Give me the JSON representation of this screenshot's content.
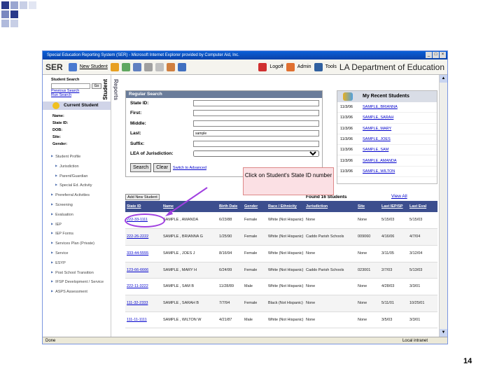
{
  "browser": {
    "title": "Special Education Reporting System (SER) - Microsoft Internet Explorer provided by Computer Aid, Inc.",
    "status_left": "Done",
    "status_right": "Local intranet"
  },
  "toolbar": {
    "app_short": "SER",
    "new_student": "New Student",
    "logoff": "Logoff",
    "admin": "Admin",
    "tools": "Tools",
    "dept": "LA Department of Education"
  },
  "left": {
    "search_title": "Student Search",
    "go": "Go",
    "links": [
      "Previous Search",
      "Run Search"
    ],
    "current": "Current Student",
    "fields": [
      "Name:",
      "State ID:",
      "DOB:",
      "Site:",
      "Gender:"
    ],
    "nav": [
      {
        "label": "Student Profile",
        "sub": false
      },
      {
        "label": "Jurisdiction",
        "sub": true
      },
      {
        "label": "Parent/Guardian",
        "sub": true
      },
      {
        "label": "Special Ed. Activity",
        "sub": true
      },
      {
        "label": "Prereferral Activities",
        "sub": false
      },
      {
        "label": "Screening",
        "sub": false
      },
      {
        "label": "Evaluation",
        "sub": false
      },
      {
        "label": "IEP",
        "sub": false
      },
      {
        "label": "IEP Forms",
        "sub": false
      },
      {
        "label": "Services Plan (Private)",
        "sub": false
      },
      {
        "label": "Service",
        "sub": false
      },
      {
        "label": "ESYP",
        "sub": false
      },
      {
        "label": "Post School Transition",
        "sub": false
      },
      {
        "label": "IFSP Development / Service",
        "sub": false
      },
      {
        "label": "ASPS Assessment",
        "sub": false
      }
    ]
  },
  "tabs": {
    "student": "Student",
    "reports": "Reports"
  },
  "search": {
    "title": "Regular Search",
    "fields": [
      {
        "label": "State ID:",
        "value": ""
      },
      {
        "label": "First:",
        "value": ""
      },
      {
        "label": "Middle:",
        "value": ""
      },
      {
        "label": "Last:",
        "value": "sample"
      },
      {
        "label": "Suffix:",
        "value": ""
      }
    ],
    "lea_label": "LEA of Jurisdiction:",
    "btn_search": "Search",
    "btn_clear": "Clear",
    "switch_link": "Switch to Advanced"
  },
  "recent": {
    "title": "My Recent Students",
    "items": [
      {
        "date": "11/3/06",
        "name": "SAMPLE, BRIANNA"
      },
      {
        "date": "11/3/06",
        "name": "SAMPLE, SARAH"
      },
      {
        "date": "11/3/06",
        "name": "SAMPLE, MARY"
      },
      {
        "date": "11/3/06",
        "name": "SAMPLE, JOES"
      },
      {
        "date": "11/3/06",
        "name": "SAMPLE, SAM"
      },
      {
        "date": "11/3/06",
        "name": "SAMPLE, AMANDA"
      },
      {
        "date": "11/3/06",
        "name": "SAMPLE, WILTON"
      }
    ]
  },
  "callout": "Click on Student's State ID number",
  "results": {
    "add_btn": "Add New Student",
    "found": "Found 16 Students",
    "view_all": "View All",
    "headers": [
      "State ID",
      "Name",
      "Birth Date",
      "Gender",
      "Race / Ethnicity",
      "Jurisdiction",
      "Site",
      "Last IEP/SP",
      "Last Eval"
    ],
    "rows": [
      [
        "222-33-1111",
        "SAMPLE , AMANDA",
        "6/23/88",
        "Female",
        "White (Not Hispanic)",
        "None",
        "None",
        "5/15/03",
        "5/15/03"
      ],
      [
        "222-26-2222",
        "SAMPLE , BRIANNA G",
        "1/25/90",
        "Female",
        "White (Not Hispanic)",
        "Caddo Parish Schools",
        "009060",
        "4/16/06",
        "4/7/04"
      ],
      [
        "333-44-5555",
        "SAMPLE , JOES J",
        "8/16/94",
        "Female",
        "White (Not Hispanic)",
        "None",
        "None",
        "3/11/05",
        "3/12/04"
      ],
      [
        "123-66-6666",
        "SAMPLE , MARY H",
        "6/24/99",
        "Female",
        "White (Not Hispanic)",
        "Caddo Parish Schools",
        "023001",
        "2/7/03",
        "5/13/03"
      ],
      [
        "222-11-3222",
        "SAMPLE , SAM B",
        "11/28/89",
        "Male",
        "White (Not Hispanic)",
        "None",
        "None",
        "4/28/03",
        "3/3/01"
      ],
      [
        "111-32-2333",
        "SAMPLE , SARAH B",
        "7/7/94",
        "Female",
        "Black (Not Hispanic)",
        "None",
        "None",
        "5/11/01",
        "10/25/01"
      ],
      [
        "111-11-1111",
        "SAMPLE , WILTON W",
        "4/21/87",
        "Male",
        "White (Not Hispanic)",
        "None",
        "None",
        "3/5/03",
        "3/3/01"
      ]
    ]
  },
  "page_number": "14",
  "colors": {
    "accent": "#3c4e8e",
    "link": "#0000cc",
    "highlight": "#a040e0"
  }
}
